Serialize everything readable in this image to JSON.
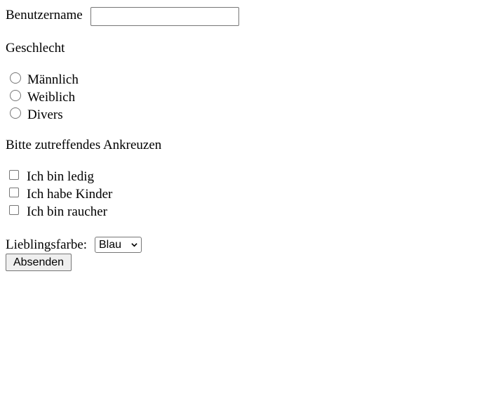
{
  "form": {
    "username": {
      "label": "Benutzername",
      "value": "",
      "placeholder": ""
    },
    "gender": {
      "heading": "Geschlecht",
      "options": [
        "Männlich",
        "Weiblich",
        "Divers"
      ]
    },
    "checks": {
      "heading": "Bitte zutreffendes Ankreuzen",
      "options": [
        "Ich bin ledig",
        "Ich habe Kinder",
        "Ich bin raucher"
      ]
    },
    "favorite_color": {
      "label": "Lieblingsfarbe:",
      "selected": "Blau"
    },
    "submit_label": "Absenden"
  }
}
